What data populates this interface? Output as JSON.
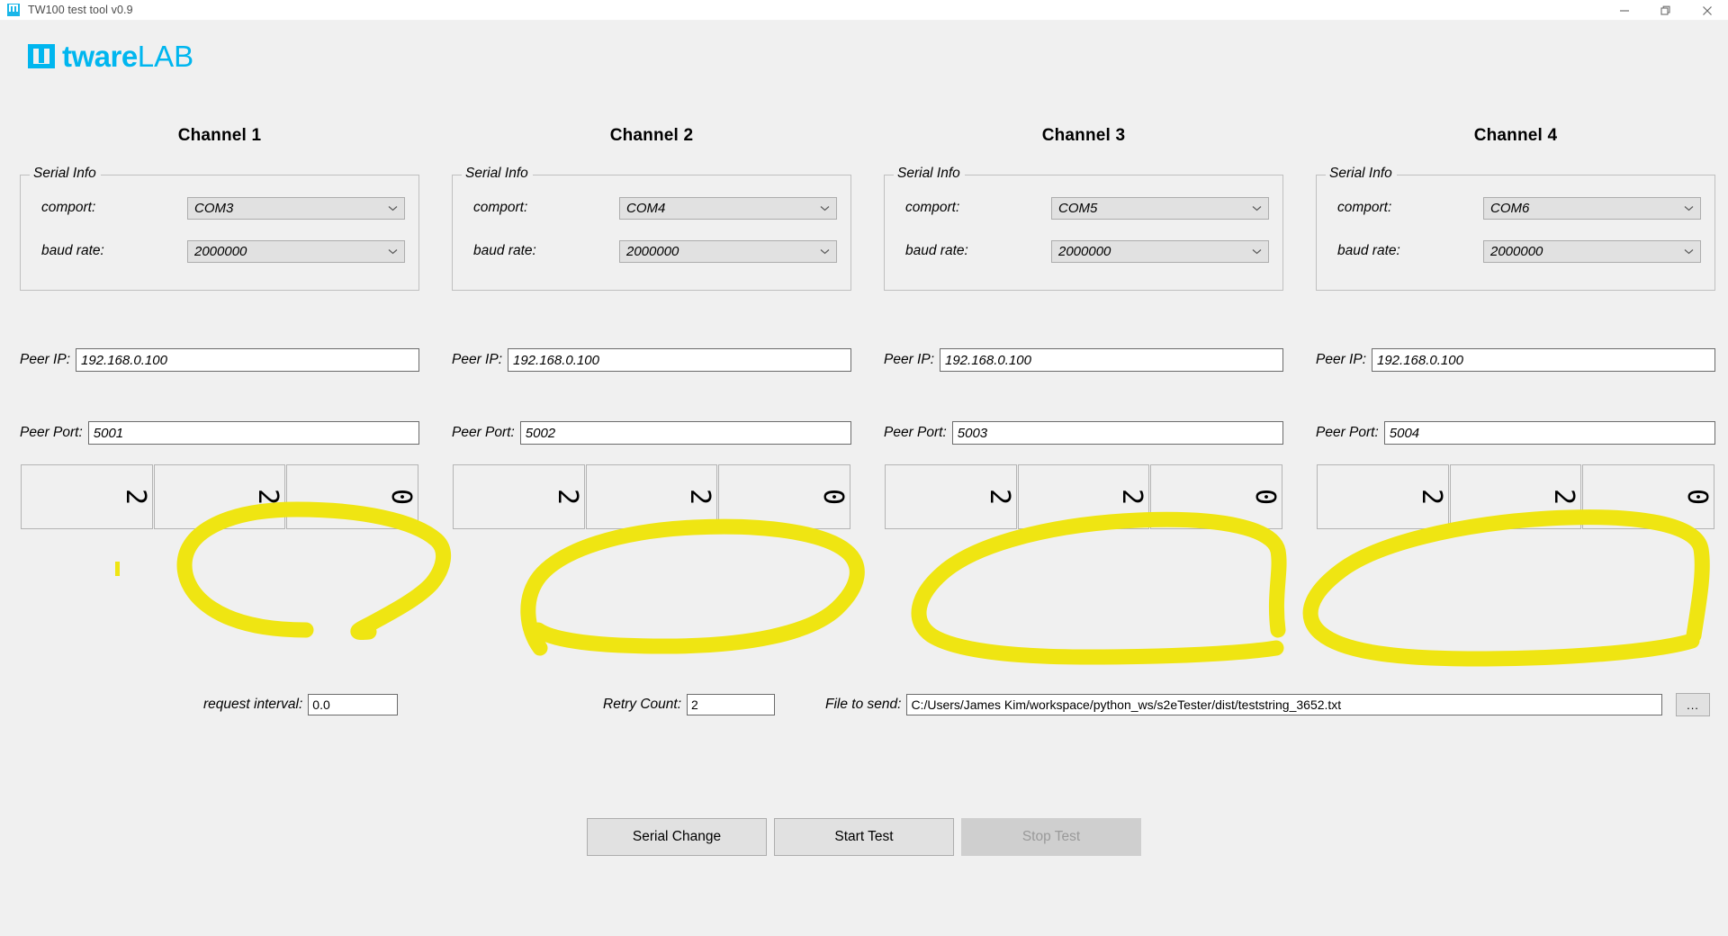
{
  "window": {
    "title": "TW100 test tool v0.9",
    "logo_icon": "tw-logo-icon",
    "controls": {
      "minimize": "minimize-icon",
      "restore": "restore-icon",
      "close": "close-icon"
    }
  },
  "brand": {
    "mark": "twarelab-logo-icon",
    "name_bold": "tware",
    "name_light": "LAB",
    "color": "#00b6ef"
  },
  "labels": {
    "serial_info": "Serial Info",
    "comport": "comport:",
    "baud_rate": "baud rate:",
    "peer_ip": "Peer IP:",
    "peer_port": "Peer Port:"
  },
  "channels": [
    {
      "title": "Channel 1",
      "comport": "COM3",
      "baud_rate": "2000000",
      "peer_ip": "192.168.0.100",
      "peer_port": "5001",
      "counters": [
        "2",
        "2",
        "0"
      ]
    },
    {
      "title": "Channel 2",
      "comport": "COM4",
      "baud_rate": "2000000",
      "peer_ip": "192.168.0.100",
      "peer_port": "5002",
      "counters": [
        "2",
        "2",
        "0"
      ]
    },
    {
      "title": "Channel 3",
      "comport": "COM5",
      "baud_rate": "2000000",
      "peer_ip": "192.168.0.100",
      "peer_port": "5003",
      "counters": [
        "2",
        "2",
        "0"
      ]
    },
    {
      "title": "Channel 4",
      "comport": "COM6",
      "baud_rate": "2000000",
      "peer_ip": "192.168.0.100",
      "peer_port": "5004",
      "counters": [
        "2",
        "2",
        "0"
      ]
    }
  ],
  "options": {
    "request_interval_label": "request interval:",
    "request_interval_value": "0.0",
    "retry_count_label": "Retry Count:",
    "retry_count_value": "2",
    "file_to_send_label": "File to send:",
    "file_to_send_value": "C:/Users/James Kim/workspace/python_ws/s2eTester/dist/teststring_3652.txt",
    "browse_label": "..."
  },
  "actions": {
    "serial_change": "Serial Change",
    "start_test": "Start Test",
    "stop_test": "Stop Test"
  },
  "annotation": {
    "type": "hand-drawn-highlight",
    "color": "#efe512",
    "shape": "ellipse-circles around counter displays of all four channels"
  }
}
